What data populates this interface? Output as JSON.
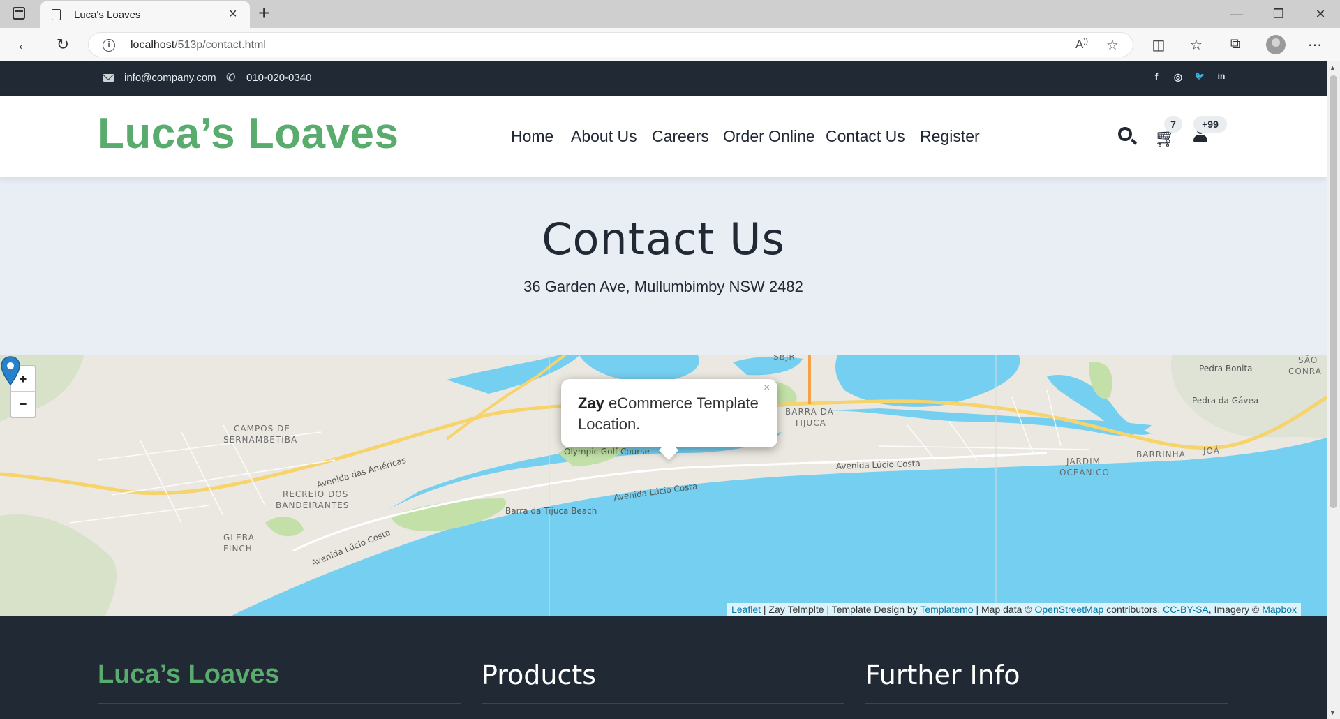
{
  "browser": {
    "tab_title": "Luca's Loaves",
    "url_host": "localhost",
    "url_path": "/513p/contact.html"
  },
  "topbar": {
    "email": "info@company.com",
    "phone": "010-020-0340",
    "social": [
      "f",
      "◎",
      "🐦",
      "in"
    ]
  },
  "header": {
    "brand": "Luca’s Loaves",
    "nav": [
      "Home",
      "About Us",
      "Careers",
      "Order Online",
      "Contact Us",
      "Register"
    ],
    "cart_count": "7",
    "user_count": "+99"
  },
  "hero": {
    "title": "Contact Us",
    "address": "36 Garden Ave, Mullumbimby NSW 2482"
  },
  "map": {
    "zoom_in": "+",
    "zoom_out": "−",
    "popup_bold": "Zay",
    "popup_text": " eCommerce Template Location.",
    "popup_close": "×",
    "labels": {
      "campos": "CAMPOS DE",
      "sernambetiba": "SERNAMBETIBA",
      "recreio": "RECREIO DOS",
      "bandeirantes": "BANDEIRANTES",
      "gleba": "GLEBA",
      "finch": "FINCH",
      "avenida_americas": "Avenida das Américas",
      "avenida_lucio_1": "Avenida Lúcio Costa",
      "avenida_lucio_2": "Avenida Lúcio Costa",
      "avenida_lucio_3": "Avenida Lúcio Costa",
      "golf": "Olympic Golf Course",
      "beach": "Barra da Tijuca Beach",
      "barra": "BARRA DA",
      "tijuca": "TIJUCA",
      "jardim": "JARDIM",
      "oceanico": "OCEÂNICO",
      "barrinha": "BARRINHA",
      "joa": "JOÁ",
      "pedra_bonita": "Pedra Bonita",
      "pedra_gavea": "Pedra da Gávea",
      "sao": "SÃO",
      "conra": "CONRA",
      "sbjr": "SBJR"
    },
    "attribution": {
      "leaflet": "Leaflet",
      "sep1": " | Zay Telmplte | Template Design by ",
      "templatemo": "Templatemo",
      "sep2": " | Map data © ",
      "osm": "OpenStreetMap",
      "sep3": " contributors, ",
      "ccbysa": "CC-BY-SA",
      "sep4": ", Imagery © ",
      "mapbox": "Mapbox"
    }
  },
  "footer": {
    "brand": "Luca’s Loaves",
    "products": "Products",
    "further": "Further Info"
  },
  "colors": {
    "brand_green": "#59ab6e",
    "dark": "#212934",
    "hero_bg": "#e9eef5",
    "water": "#75cff0",
    "link": "#0078a8"
  }
}
